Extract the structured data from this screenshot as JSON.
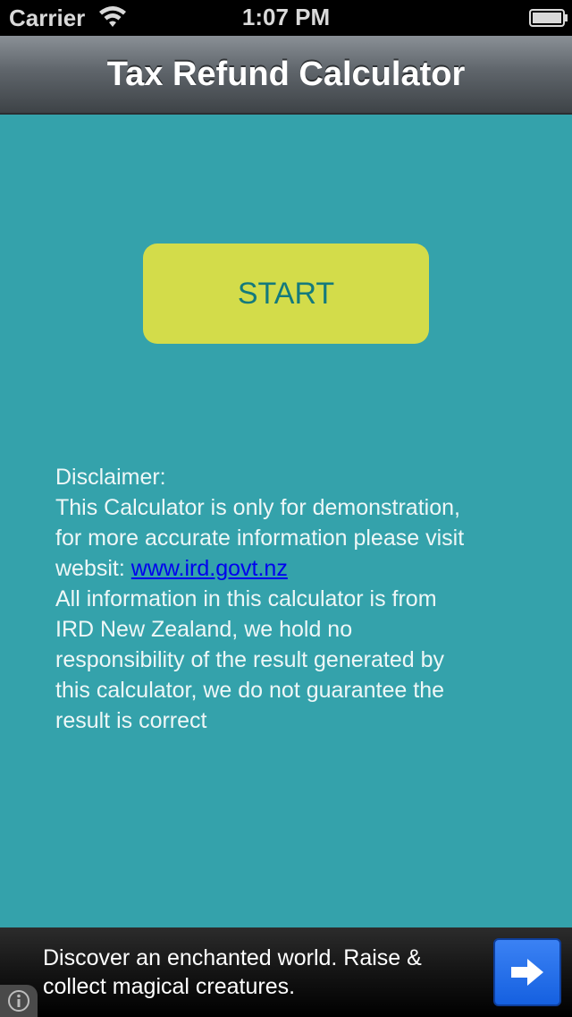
{
  "status_bar": {
    "carrier": "Carrier",
    "time": "1:07 PM",
    "wifi_icon": "wifi-icon",
    "battery_icon": "battery-icon"
  },
  "nav_bar": {
    "title": "Tax Refund Calculator"
  },
  "main": {
    "start_label": "START",
    "start_color": "#d3dc4a",
    "background_color": "#34a2ab"
  },
  "disclaimer": {
    "heading": "Disclaimer:",
    "line1": "This Calculator is only for demonstration,",
    "line2": "for more accurate information please visit",
    "line3_prefix": "websit: ",
    "link_text": "www.ird.govt.nz",
    "line4": "All information in this calculator is from",
    "line5": "IRD New Zealand, we hold no",
    "line6": "responsibility of the result generated by",
    "line7": "this calculator, we do not guarantee the",
    "line8": "result is correct"
  },
  "ad": {
    "line1": "Discover an enchanted world. Raise &",
    "line2": "collect magical creatures.",
    "arrow_icon": "arrow-right-icon",
    "info_icon": "info-icon"
  }
}
